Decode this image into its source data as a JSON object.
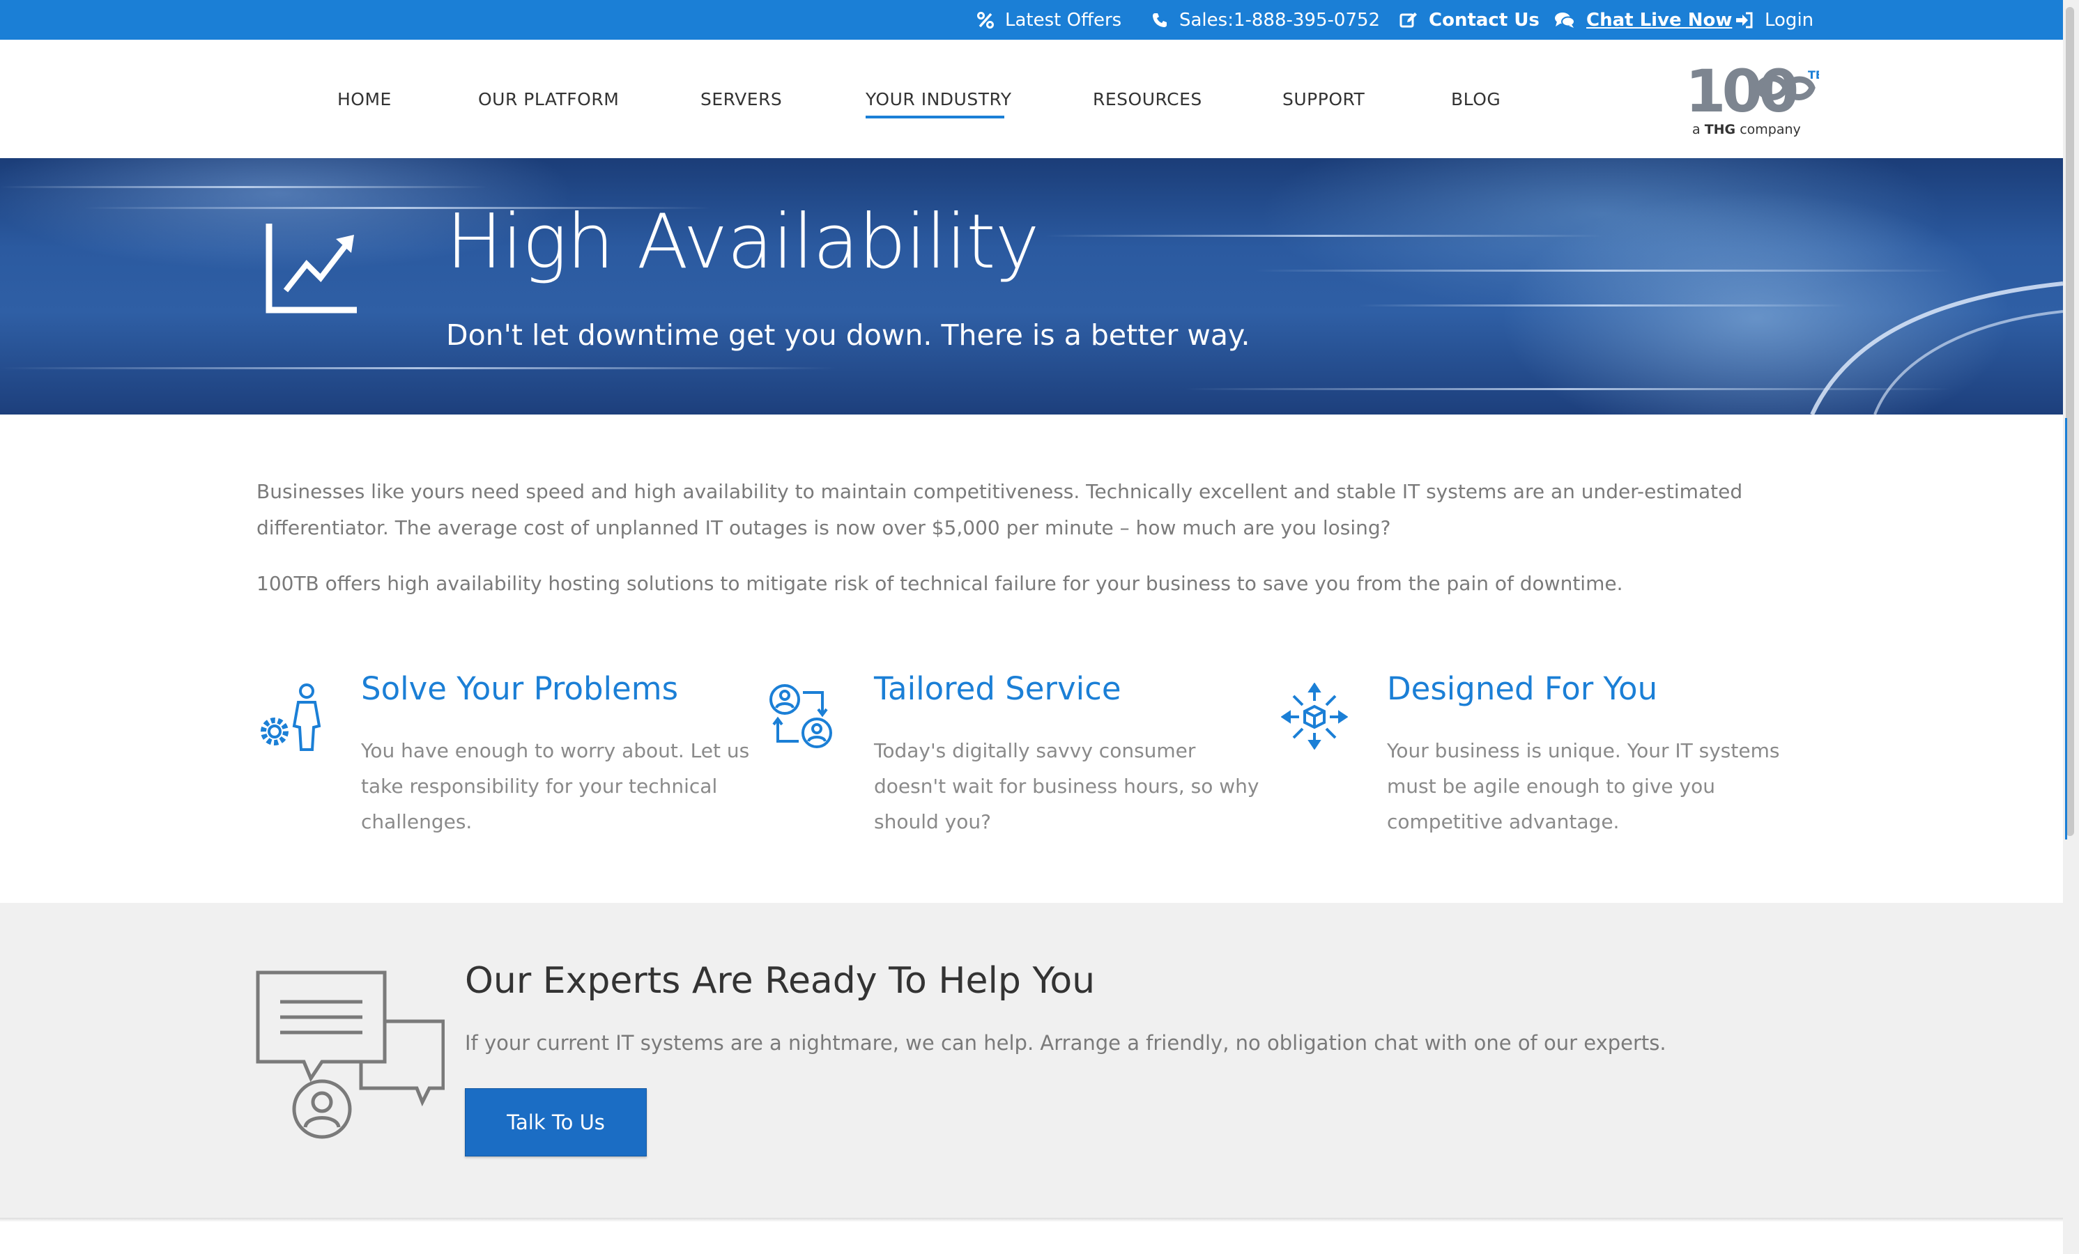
{
  "topbar": {
    "items": [
      {
        "icon": "percent-icon",
        "label": "Latest Offers"
      },
      {
        "icon": "phone-icon",
        "label": "Sales:1-888-395-0752"
      },
      {
        "icon": "edit-icon",
        "label": "Contact Us"
      },
      {
        "icon": "chat-bubbles-icon",
        "label": "Chat Live Now"
      },
      {
        "icon": "login-icon",
        "label": "Login"
      }
    ]
  },
  "nav": {
    "items": [
      "HOME",
      "OUR PLATFORM",
      "SERVERS",
      "YOUR INDUSTRY",
      "RESOURCES",
      "SUPPORT",
      "BLOG"
    ],
    "active": "YOUR INDUSTRY"
  },
  "logo": {
    "mark": "100",
    "superscript": "TB",
    "tagline_pre": "a ",
    "tagline_brand": "THG",
    "tagline_post": " company"
  },
  "hero": {
    "icon": "growth-chart-icon",
    "title": "High Availability",
    "subtitle": "Don't let downtime get you down. There is a better way."
  },
  "intro": {
    "p1": "Businesses like yours need speed and high availability to maintain competitiveness. Technically excellent and stable IT systems are an under-estimated differentiator. The average cost of unplanned IT outages is now over $5,000 per minute – how much are you losing?",
    "p2": "100TB offers high availability hosting solutions to mitigate risk of technical failure for your business to save you from the pain of downtime."
  },
  "features": [
    {
      "icon": "person-gear-icon",
      "title": "Solve Your Problems",
      "text": "You have enough to worry about. Let us take responsibility for your technical challenges."
    },
    {
      "icon": "user-exchange-icon",
      "title": "Tailored Service",
      "text": "Today's digitally savvy consumer doesn't wait for business hours, so why should you?"
    },
    {
      "icon": "cube-network-icon",
      "title": "Designed For You",
      "text": "Your business is unique. Your IT systems must be agile enough to give you competitive advantage."
    }
  ],
  "experts": {
    "icon": "speech-bubbles-user-icon",
    "title": "Our Experts Are Ready To Help You",
    "text": "If your current IT systems are a nightmare, we can help. Arrange a friendly, no obligation chat with one of our experts.",
    "button": "Talk To Us"
  },
  "colors": {
    "accent": "#1b7fd6",
    "button": "#1b6dc4",
    "band": "#f0f0f0",
    "body_text": "#7a7a7a"
  }
}
